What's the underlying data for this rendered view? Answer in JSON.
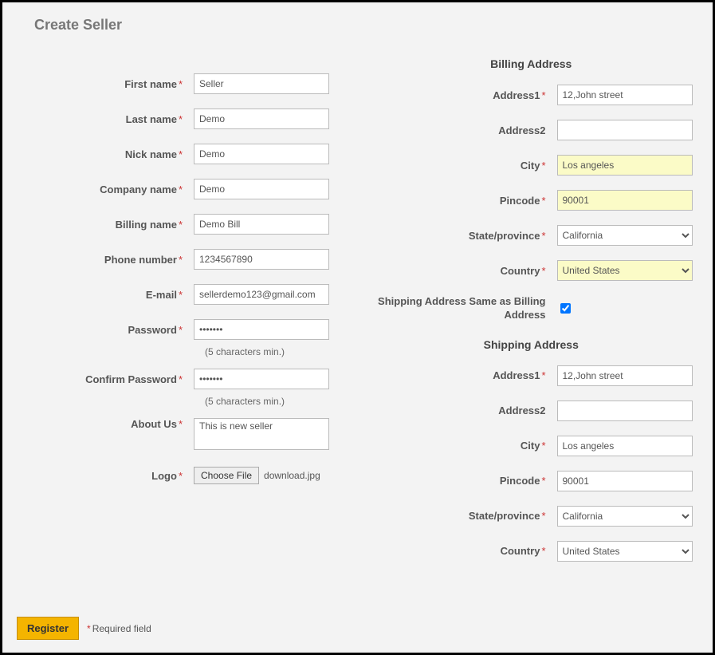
{
  "title": "Create Seller",
  "left": {
    "first_name": {
      "label": "First name",
      "value": "Seller"
    },
    "last_name": {
      "label": "Last name",
      "value": "Demo"
    },
    "nick_name": {
      "label": "Nick name",
      "value": "Demo"
    },
    "company_name": {
      "label": "Company name",
      "value": "Demo"
    },
    "billing_name": {
      "label": "Billing name",
      "value": "Demo Bill"
    },
    "phone": {
      "label": "Phone number",
      "value": "1234567890"
    },
    "email": {
      "label": "E-mail",
      "value": "sellerdemo123@gmail.com"
    },
    "password": {
      "label": "Password",
      "value": "•••••••",
      "hint": "(5 characters min.)"
    },
    "confirm_password": {
      "label": "Confirm Password",
      "value": "•••••••",
      "hint": "(5 characters min.)"
    },
    "about_us": {
      "label": "About Us",
      "value": "This is new seller"
    },
    "logo": {
      "label": "Logo",
      "button": "Choose File",
      "filename": "download.jpg"
    }
  },
  "billing": {
    "heading": "Billing Address",
    "address1": {
      "label": "Address1",
      "value": "12,John street"
    },
    "address2": {
      "label": "Address2",
      "value": ""
    },
    "city": {
      "label": "City",
      "value": "Los angeles"
    },
    "pincode": {
      "label": "Pincode",
      "value": "90001"
    },
    "state": {
      "label": "State/province",
      "value": "California"
    },
    "country": {
      "label": "Country",
      "value": "United States"
    }
  },
  "same_as": {
    "label": "Shipping Address Same as Billing Address",
    "checked": true
  },
  "shipping": {
    "heading": "Shipping Address",
    "address1": {
      "label": "Address1",
      "value": "12,John street"
    },
    "address2": {
      "label": "Address2",
      "value": ""
    },
    "city": {
      "label": "City",
      "value": "Los angeles"
    },
    "pincode": {
      "label": "Pincode",
      "value": "90001"
    },
    "state": {
      "label": "State/province",
      "value": "California"
    },
    "country": {
      "label": "Country",
      "value": "United States"
    }
  },
  "footer": {
    "register": "Register",
    "required_note": "Required field"
  }
}
